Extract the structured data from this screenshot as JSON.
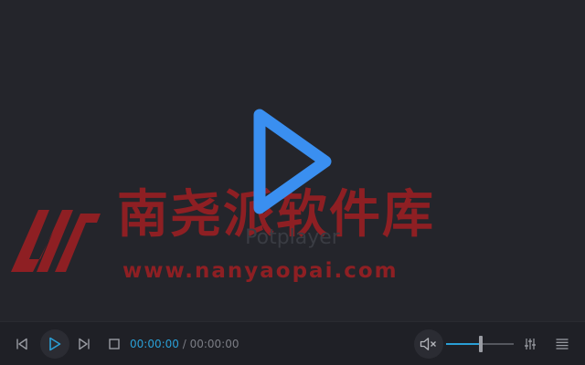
{
  "app": {
    "brand": "Potplayer"
  },
  "watermark": {
    "chinese": "南尧派软件库",
    "url": "www.nanyaopai.com"
  },
  "controls": {
    "time_current": "00:00:00",
    "time_separator": " / ",
    "time_duration": "00:00:00",
    "volume_level": 0.52
  },
  "icons": {
    "big_play": "play-icon",
    "prev": "previous-icon",
    "play": "play-icon",
    "next": "next-icon",
    "stop": "stop-icon",
    "mute": "mute-icon",
    "equalizer": "equalizer-icon",
    "menu": "menu-icon"
  },
  "colors": {
    "accent": "#2a9fd6",
    "big_play": "#3a8ff0",
    "watermark": "#8e1f23",
    "background": "#24252b"
  }
}
